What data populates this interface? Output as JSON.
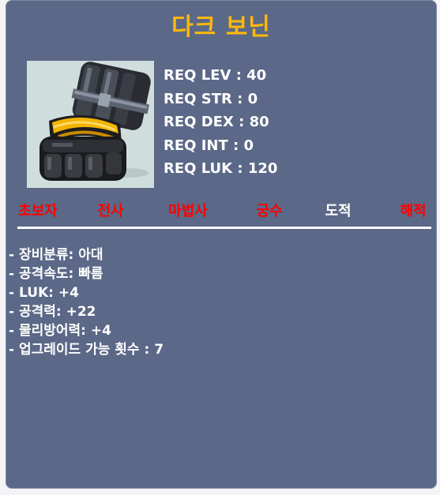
{
  "item": {
    "name": "다크 보닌",
    "icon": "dark-glove-icon"
  },
  "requirements": [
    {
      "label": "REQ LEV",
      "value": "40"
    },
    {
      "label": "REQ STR",
      "value": "0"
    },
    {
      "label": "REQ DEX",
      "value": "80"
    },
    {
      "label": "REQ INT",
      "value": "0"
    },
    {
      "label": "REQ LUK",
      "value": "120"
    }
  ],
  "jobs": [
    {
      "name": "초보자",
      "color": "#ff0000"
    },
    {
      "name": "전사",
      "color": "#ff0000"
    },
    {
      "name": "마법사",
      "color": "#ff0000"
    },
    {
      "name": "궁수",
      "color": "#ff0000"
    },
    {
      "name": "도적",
      "color": "#ffffff"
    },
    {
      "name": "해적",
      "color": "#ff0000"
    }
  ],
  "stats": [
    "- 장비분류: 아대",
    "- 공격속도: 빠름",
    "- LUK: +4",
    "- 공격력: +22",
    "- 물리방어력: +4",
    "- 업그레이드 가능 횟수 : 7"
  ],
  "colors": {
    "panel_bg": "#5b6887",
    "title": "#ffb80a",
    "icon_bg": "#cfdedd",
    "job_available": "#ffffff",
    "job_unavailable": "#ff0000"
  }
}
